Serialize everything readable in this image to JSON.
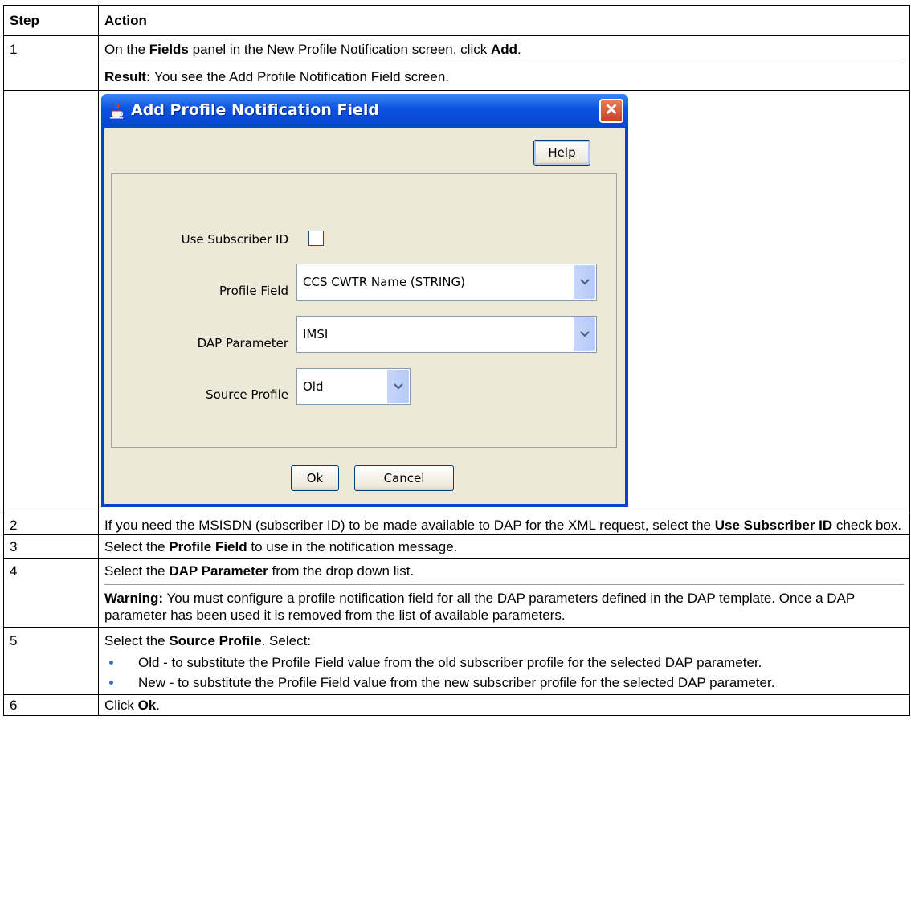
{
  "table": {
    "headers": {
      "step": "Step",
      "action": "Action"
    },
    "row1": {
      "step": "1",
      "a_pre": "On the ",
      "a_bold": "Fields",
      "a_mid": " panel in the New Profile Notification screen, click ",
      "a_bold2": "Add",
      "a_end": ".",
      "result_label": "Result:",
      "result_text": " You see the Add Profile Notification Field screen."
    },
    "row2": {
      "step": "2",
      "pre": "If you need the MSISDN (subscriber ID) to be made available to DAP for the XML request, select the ",
      "bold": "Use Subscriber ID",
      "end": " check box."
    },
    "row3": {
      "step": "3",
      "pre": "Select the ",
      "bold": "Profile Field",
      "end": " to use in the notification message."
    },
    "row4": {
      "step": "4",
      "pre": "Select the ",
      "bold": "DAP Parameter",
      "end": " from the drop down list.",
      "warning_label": "Warning:",
      "warning_text": " You must configure a profile notification field for all the DAP parameters defined in the DAP template. Once a DAP parameter has been used it is removed from the list of available parameters."
    },
    "row5": {
      "step": "5",
      "pre": "Select the ",
      "bold": "Source Profile",
      "end": ". Select:",
      "bullets": [
        "Old - to substitute the Profile Field value from the old subscriber profile for the selected DAP parameter.",
        "New - to substitute the Profile Field value from the new subscriber profile for the selected DAP parameter."
      ]
    },
    "row6": {
      "step": "6",
      "pre": "Click ",
      "bold": "Ok",
      "end": "."
    }
  },
  "dialog": {
    "title": "Add Profile Notification Field",
    "close_glyph": "✕",
    "help_label": "Help",
    "use_subscriber_id_label": "Use Subscriber ID",
    "use_subscriber_id_checked": false,
    "profile_field_label": "Profile Field",
    "profile_field_value": "CCS CWTR Name (STRING)",
    "dap_parameter_label": "DAP Parameter",
    "dap_parameter_value": "IMSI",
    "source_profile_label": "Source Profile",
    "source_profile_value": "Old",
    "ok_label": "Ok",
    "cancel_label": "Cancel"
  },
  "colors": {
    "titlebar": "#0a52e0",
    "dialog_bg": "#ece9d8",
    "bullet": "#2b6fc7",
    "close": "#c8401e"
  }
}
